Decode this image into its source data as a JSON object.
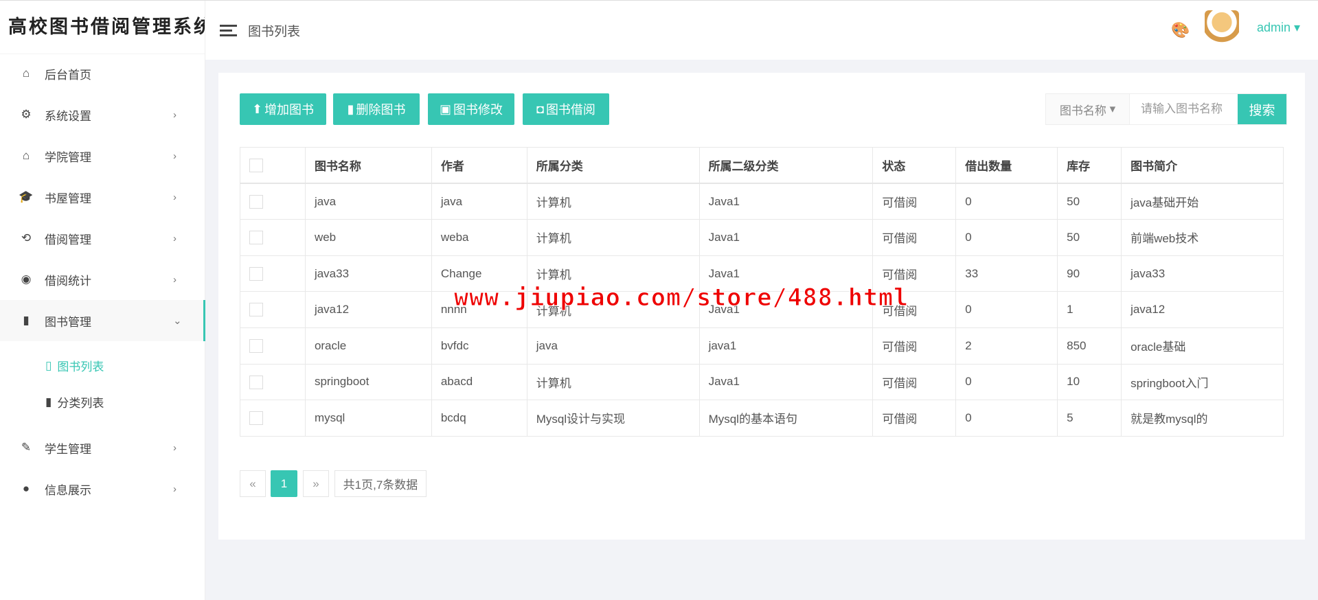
{
  "app_title": "高校图书借阅管理系统",
  "header": {
    "page_title": "图书列表",
    "user": "admin"
  },
  "sidebar": {
    "items": [
      {
        "label": "后台首页",
        "icon": "home-icon",
        "chev": ""
      },
      {
        "label": "系统设置",
        "icon": "gear-icon",
        "chev": "›"
      },
      {
        "label": "学院管理",
        "icon": "house-icon",
        "chev": "›"
      },
      {
        "label": "书屋管理",
        "icon": "graduation-cap-icon",
        "chev": "›"
      },
      {
        "label": "借阅管理",
        "icon": "refresh-icon",
        "chev": "›"
      },
      {
        "label": "借阅统计",
        "icon": "aperture-icon",
        "chev": "›"
      },
      {
        "label": "图书管理",
        "icon": "clipboard-icon",
        "chev": "⌄"
      },
      {
        "label": "学生管理",
        "icon": "pencil-icon",
        "chev": "›"
      },
      {
        "label": "信息展示",
        "icon": "user-icon",
        "chev": "›"
      }
    ],
    "sub_items": [
      {
        "label": "图书列表"
      },
      {
        "label": "分类列表"
      }
    ]
  },
  "toolbar": {
    "add": "增加图书",
    "delete": "删除图书",
    "edit": "图书修改",
    "borrow": "图书借阅"
  },
  "search": {
    "field": "图书名称",
    "placeholder": "请输入图书名称",
    "button": "搜索"
  },
  "table": {
    "headers": [
      "图书名称",
      "作者",
      "所属分类",
      "所属二级分类",
      "状态",
      "借出数量",
      "库存",
      "图书简介"
    ],
    "rows": [
      [
        "java",
        "java",
        "计算机",
        "Java1",
        "可借阅",
        "0",
        "50",
        "java基础开始"
      ],
      [
        "web",
        "weba",
        "计算机",
        "Java1",
        "可借阅",
        "0",
        "50",
        "前端web技术"
      ],
      [
        "java33",
        "Change",
        "计算机",
        "Java1",
        "可借阅",
        "33",
        "90",
        "java33"
      ],
      [
        "java12",
        "nnnn",
        "计算机",
        "Java1",
        "可借阅",
        "0",
        "1",
        "java12"
      ],
      [
        "oracle",
        "bvfdc",
        "java",
        "java1",
        "可借阅",
        "2",
        "850",
        "oracle基础"
      ],
      [
        "springboot",
        "abacd",
        "计算机",
        "Java1",
        "可借阅",
        "0",
        "10",
        "springboot入门"
      ],
      [
        "mysql",
        "bcdq",
        "Mysql设计与实现",
        "Mysql的基本语句",
        "可借阅",
        "0",
        "5",
        "就是教mysql的"
      ]
    ]
  },
  "pagination": {
    "prev": "«",
    "current": "1",
    "next": "»",
    "info": "共1页,7条数据"
  },
  "watermark": "www.jiupiao.com/store/488.html",
  "colors": {
    "accent": "#37c6b3"
  }
}
